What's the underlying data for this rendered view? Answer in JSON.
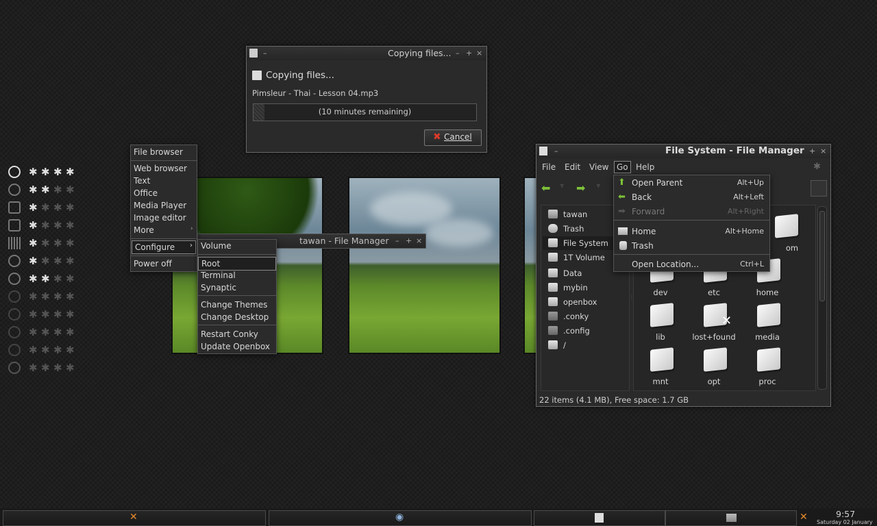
{
  "copy_dialog": {
    "title": "Copying files...",
    "heading": "Copying files...",
    "filename": "Pimsleur - Thai - Lesson 04.mp3",
    "progress_text": "(10 minutes remaining)",
    "progress": 0.05,
    "cancel_label": "Cancel"
  },
  "main_menu": {
    "items": [
      "File browser",
      "Web browser",
      "Text",
      "Office",
      "Media Player",
      "Image editor",
      "More",
      "Configure",
      "Power off"
    ]
  },
  "configure_submenu": {
    "items": [
      "Volume",
      "Root",
      "Terminal",
      "Synaptic",
      "Change Themes",
      "Change Desktop",
      "Restart Conky",
      "Update Openbox"
    ]
  },
  "bg_window": {
    "title": "tawan - File Manager"
  },
  "file_manager": {
    "title": "File System - File Manager",
    "menu": [
      "File",
      "Edit",
      "View",
      "Go",
      "Help"
    ],
    "sidebar": [
      "tawan",
      "Trash",
      "File System",
      "1T Volume",
      "Data",
      "mybin",
      "openbox",
      ".conky",
      ".config",
      "/"
    ],
    "folders": [
      "dev",
      "etc",
      "home",
      "lib",
      "lost+found",
      "media",
      "mnt",
      "opt",
      "proc"
    ],
    "partial_label": "om",
    "status": "22 items (4.1 MB), Free space: 1.7 GB"
  },
  "go_menu": {
    "items": [
      {
        "label": "Open Parent",
        "shortcut": "Alt+Up"
      },
      {
        "label": "Back",
        "shortcut": "Alt+Left"
      },
      {
        "label": "Forward",
        "shortcut": "Alt+Right"
      },
      {
        "label": "Home",
        "shortcut": "Alt+Home"
      },
      {
        "label": "Trash",
        "shortcut": ""
      },
      {
        "label": "Open Location...",
        "shortcut": "Ctrl+L"
      }
    ]
  },
  "clock": {
    "time": "9:57",
    "date": "Saturday 02 January"
  },
  "colors": {
    "accent_green": "#7ec23a",
    "cancel_red": "#d93a2a"
  }
}
